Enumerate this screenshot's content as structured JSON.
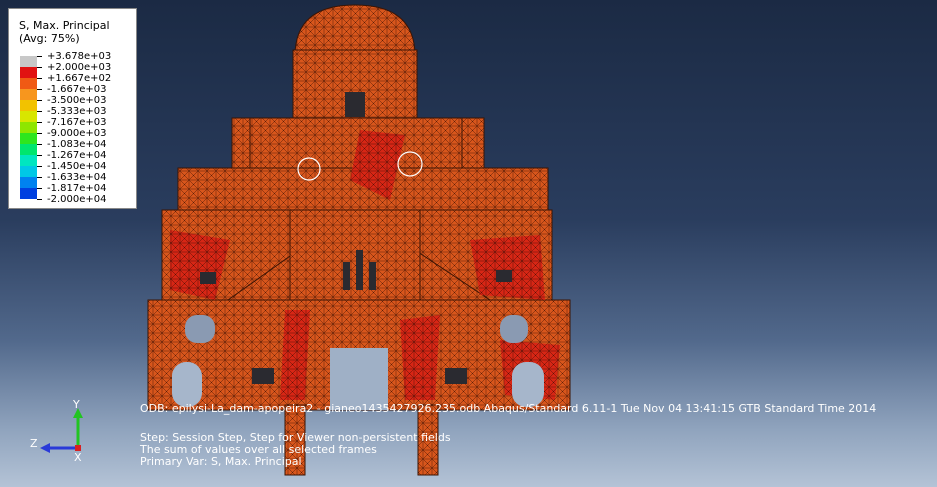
{
  "legend": {
    "title_line1": "S, Max. Principal",
    "title_line2": "(Avg: 75%)",
    "entries": [
      {
        "label": "+3.678e+03",
        "color": "#c8c8c8"
      },
      {
        "label": "+2.000e+03",
        "color": "#e11212"
      },
      {
        "label": "+1.667e+02",
        "color": "#f05a14"
      },
      {
        "label": "-1.667e+03",
        "color": "#f7961e"
      },
      {
        "label": "-3.500e+03",
        "color": "#f2c200"
      },
      {
        "label": "-5.333e+03",
        "color": "#d8e600"
      },
      {
        "label": "-7.167e+03",
        "color": "#8ee600"
      },
      {
        "label": "-9.000e+03",
        "color": "#2ee61e"
      },
      {
        "label": "-1.083e+04",
        "color": "#00e66e"
      },
      {
        "label": "-1.267e+04",
        "color": "#00e6c0"
      },
      {
        "label": "-1.450e+04",
        "color": "#00c8e6"
      },
      {
        "label": "-1.633e+04",
        "color": "#0082f0"
      },
      {
        "label": "-1.817e+04",
        "color": "#0040e0"
      },
      {
        "label": "-2.000e+04",
        "color": "#0000c8"
      }
    ]
  },
  "info_line": "ODB: epilysi-La_dam-apopeira2 - gianeo1435427926.235.odb    Abaqus/Standard 6.11-1    Tue Nov 04 13:41:15 GTB Standard Time 2014",
  "step_lines": [
    "Step: Session Step, Step for Viewer non-persistent fields",
    "The sum of values over all selected frames",
    "Primary Var: S, Max. Principal"
  ],
  "triad": {
    "y": "Y",
    "z": "Z",
    "x": "X"
  },
  "model_colors": {
    "mesh_fill": "#d8561c",
    "mesh_line": "#5a1e08",
    "high_stress": "#d81e14"
  }
}
